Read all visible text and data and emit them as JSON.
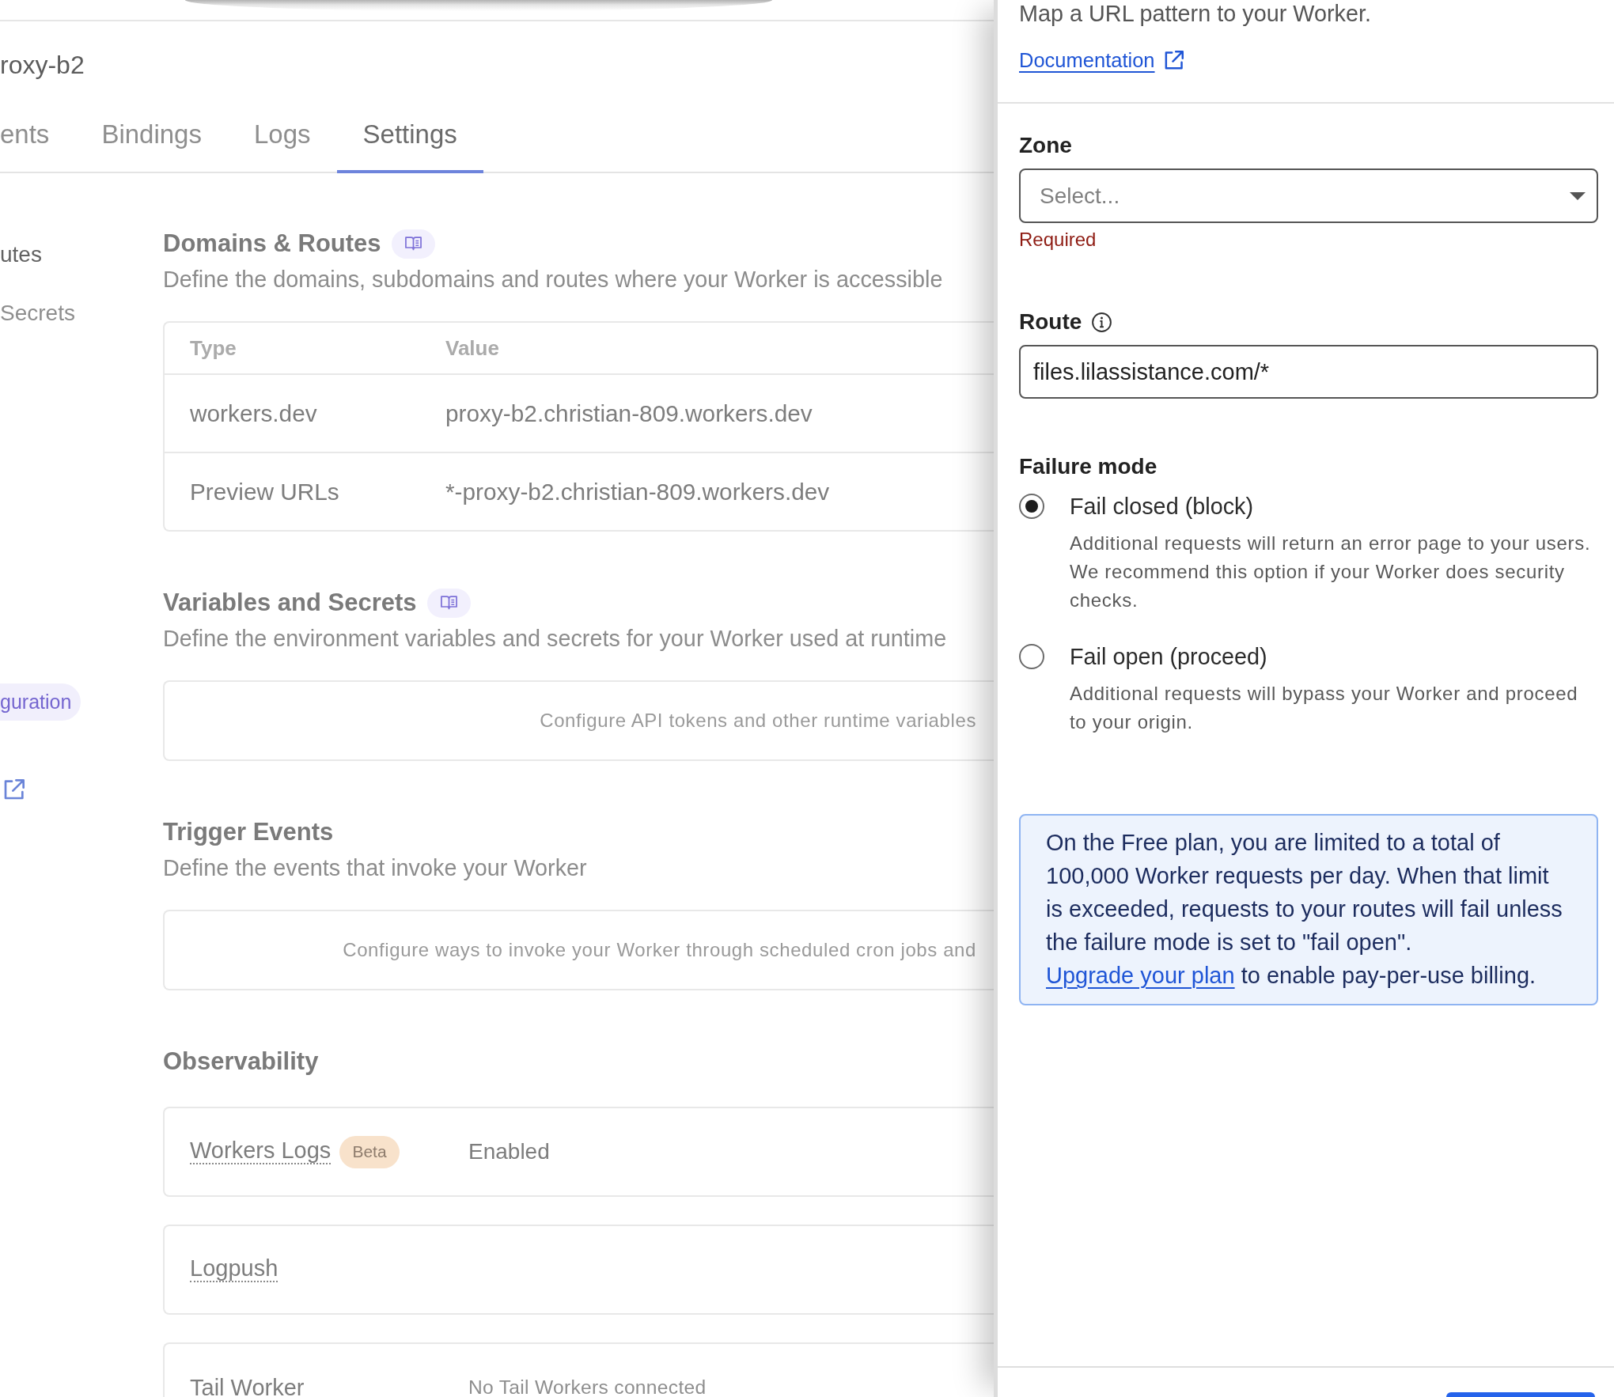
{
  "worker_name": "roxy-b2",
  "tabs": [
    {
      "label": "ents",
      "selected": false
    },
    {
      "label": "Bindings",
      "selected": false
    },
    {
      "label": "Logs",
      "selected": false
    },
    {
      "label": "Settings",
      "selected": true
    }
  ],
  "side_nav": {
    "items": [
      {
        "label": "utes",
        "selected": true
      },
      {
        "label": "Secrets",
        "selected": false
      }
    ],
    "config_button": "guration"
  },
  "sections": [
    {
      "kind": "table",
      "title": "Domains & Routes",
      "docs_link": true,
      "description": "Define the domains, subdomains and routes where your Worker is accessible",
      "table": {
        "columns": [
          "Type",
          "Value"
        ],
        "rows": [
          [
            "workers.dev",
            "proxy-b2.christian-809.workers.dev"
          ],
          [
            "Preview URLs",
            "*-proxy-b2.christian-809.workers.dev"
          ]
        ]
      }
    },
    {
      "kind": "empty",
      "title": "Variables and Secrets",
      "docs_link": true,
      "description": "Define the environment variables and secrets for your Worker used at runtime",
      "empty_text": "Configure API tokens and other runtime variables"
    },
    {
      "kind": "empty",
      "title": "Trigger Events",
      "docs_link": false,
      "description": "Define the events that invoke your Worker",
      "empty_text": "Configure ways to invoke your Worker through scheduled cron jobs and"
    },
    {
      "kind": "cards",
      "title": "Observability",
      "docs_link": false,
      "cards": [
        {
          "kind": "status",
          "label": "Workers Logs",
          "has_tooltip": true,
          "badge": "Beta",
          "value": "Enabled"
        },
        {
          "kind": "plain",
          "label": "Logpush",
          "has_tooltip": true
        },
        {
          "kind": "note",
          "label": "Tail Worker",
          "value": "No Tail Workers connected"
        }
      ]
    }
  ],
  "route_panel": {
    "intro": "Map a URL pattern to your Worker.",
    "doc_link": "Documentation",
    "zone": {
      "label": "Zone",
      "placeholder": "Select...",
      "error": "Required"
    },
    "route": {
      "label": "Route",
      "value": "files.lilassistance.com/*"
    },
    "failure_mode": {
      "label": "Failure mode",
      "options": [
        {
          "label": "Fail closed (block)",
          "description": "Additional requests will return an error page to your users. We recommend this option if your Worker does security checks.",
          "selected": true
        },
        {
          "label": "Fail open (proceed)",
          "description": "Additional requests will bypass your Worker and proceed to your origin.",
          "selected": false
        }
      ]
    },
    "notice": {
      "text": "On the Free plan, you are limited to a total of 100,000 Worker requests per day. When that limit is exceeded, requests to your routes will fail unless the failure mode is set to \"fail open\".",
      "link": "Upgrade your plan",
      "text_after": "to enable pay-per-use billing."
    }
  }
}
